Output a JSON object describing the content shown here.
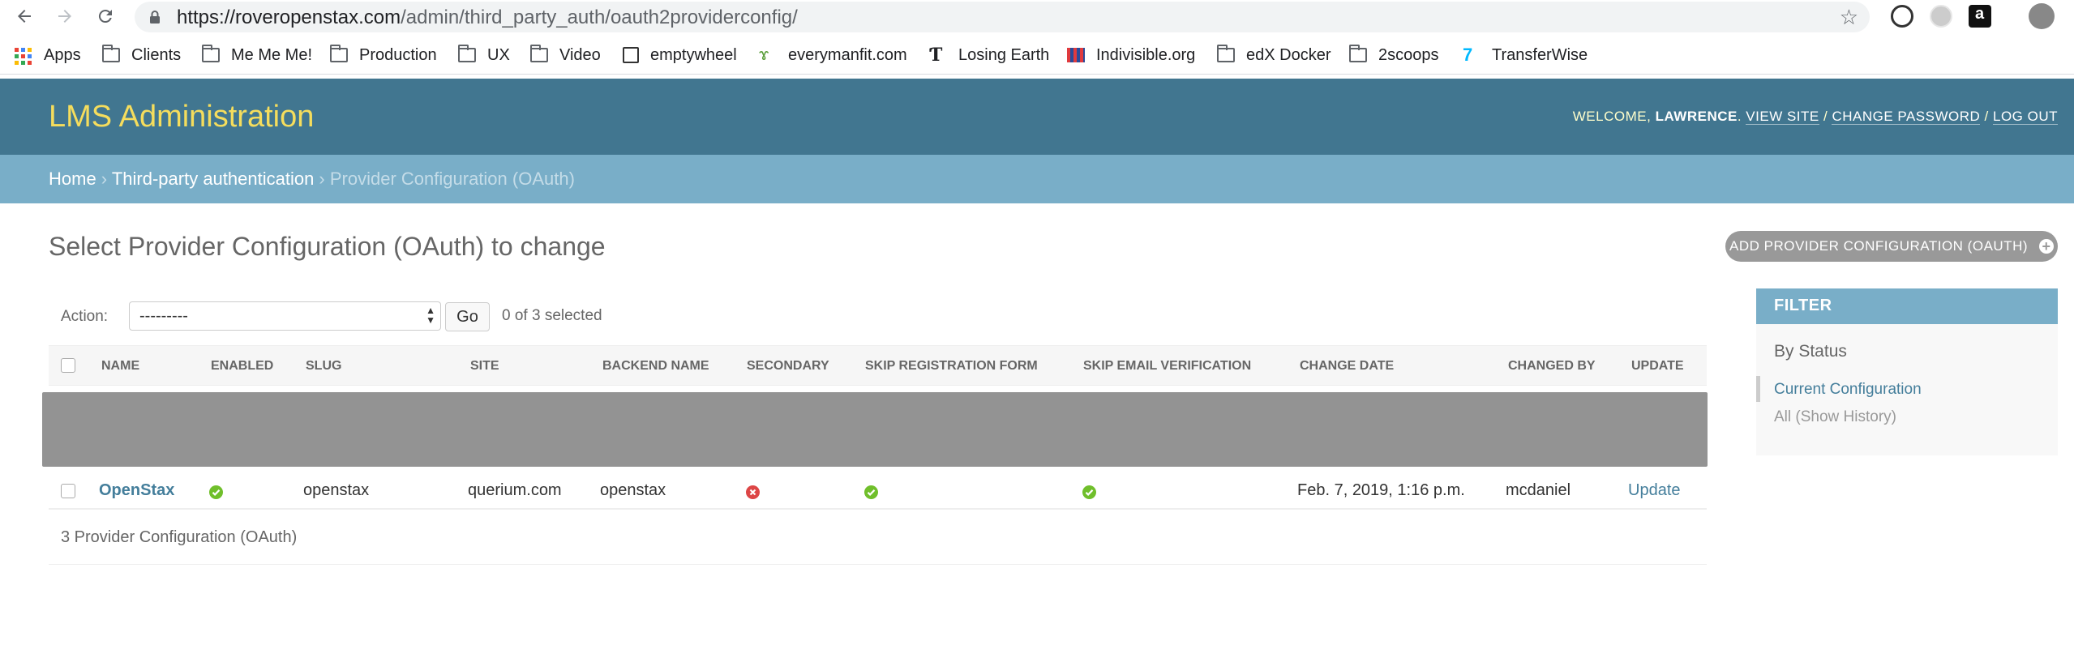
{
  "browser": {
    "url_host": "https://roveropenstax.com",
    "url_path": "/admin/third_party_auth/oauth2providerconfig/",
    "bookmarks": [
      {
        "label": "Apps",
        "icon": "apps-grid-icon"
      },
      {
        "label": "Clients",
        "icon": "folder-icon"
      },
      {
        "label": "Me Me Me!",
        "icon": "folder-icon"
      },
      {
        "label": "Production",
        "icon": "folder-icon"
      },
      {
        "label": "UX",
        "icon": "folder-icon"
      },
      {
        "label": "Video",
        "icon": "folder-icon"
      },
      {
        "label": "emptywheel",
        "icon": "site-icon"
      },
      {
        "label": "everymanfit.com",
        "icon": "site-icon"
      },
      {
        "label": "Losing Earth",
        "icon": "nyt-icon"
      },
      {
        "label": "Indivisible.org",
        "icon": "site-icon"
      },
      {
        "label": "edX Docker",
        "icon": "folder-icon"
      },
      {
        "label": "2scoops",
        "icon": "folder-icon"
      },
      {
        "label": "TransferWise",
        "icon": "site-icon"
      }
    ]
  },
  "header": {
    "brand": "LMS Administration",
    "welcome": "WELCOME, ",
    "user": "LAWRENCE",
    "view_site": "VIEW SITE",
    "change_password": "CHANGE PASSWORD",
    "log_out": "LOG OUT"
  },
  "breadcrumbs": {
    "home": "Home",
    "app": "Third-party authentication",
    "current": "Provider Configuration (OAuth)"
  },
  "main": {
    "title": "Select Provider Configuration (OAuth) to change",
    "add_button": "ADD PROVIDER CONFIGURATION (OAUTH)",
    "action_label": "Action:",
    "action_value": "---------",
    "go_label": "Go",
    "selected_counter": "0 of 3 selected",
    "columns": [
      "NAME",
      "ENABLED",
      "SLUG",
      "SITE",
      "BACKEND NAME",
      "SECONDARY",
      "SKIP REGISTRATION FORM",
      "SKIP EMAIL VERIFICATION",
      "CHANGE DATE",
      "CHANGED BY",
      "UPDATE"
    ],
    "row": {
      "name": "OpenStax",
      "enabled": true,
      "slug": "openstax",
      "site": "querium.com",
      "backend_name": "openstax",
      "secondary": false,
      "skip_registration_form": true,
      "skip_email_verification": true,
      "change_date": "Feb. 7, 2019, 1:16 p.m.",
      "changed_by": "mcdaniel",
      "update": "Update"
    },
    "paginator": "3 Provider Configuration (OAuth)"
  },
  "filter": {
    "title": "FILTER",
    "subtitle": "By Status",
    "options": [
      "Current Configuration",
      "All (Show History)"
    ]
  },
  "colors": {
    "header_bg": "#417690",
    "brand": "#f5dd5d",
    "breadcrumb_bg": "#79aec8",
    "link": "#447e9b",
    "yes_icon": "#70bf2b",
    "no_icon": "#dd4646"
  }
}
